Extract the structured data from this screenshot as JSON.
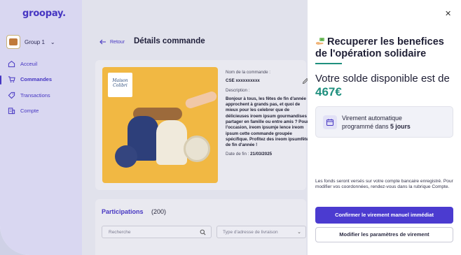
{
  "app": {
    "logo": "groopay."
  },
  "sidebar": {
    "group_label": "Group 1",
    "items": [
      {
        "label": "Acceuil",
        "icon": "home-icon",
        "active": false
      },
      {
        "label": "Commandes",
        "icon": "cart-icon",
        "active": true
      },
      {
        "label": "Transactions",
        "icon": "tag-icon",
        "active": false
      },
      {
        "label": "Compte",
        "icon": "building-icon",
        "active": false
      }
    ]
  },
  "header": {
    "back_label": "Retour",
    "title": "Détails commande"
  },
  "order": {
    "brand_tag": "Maison Colibri",
    "name_label": "Nom de la commande :",
    "name_value": "CSE xxxxxxxxxx",
    "description_label": "Description :",
    "description_text": "Bonjour à tous, les fêtes de fin d'année approchent à grands pas, et quoi de mieux pour les celebrer que de délicieuses iroem ipsum gourmandises à partager en famille ou entre amis ? Pour l'occasion, ireom ipsumje lence ireom ipsum cette commande groupée spécifique. Profitez des ireom ipsumfêtes de fin d'année !",
    "end_date_label": "Date de fin :",
    "end_date_value": "21/03/2025"
  },
  "participations": {
    "title": "Participations",
    "count": "(200)",
    "search_placeholder": "Recherche",
    "address_placeholder": "Type d'adresse de livraison"
  },
  "drawer": {
    "title": "Recuperer les benefices de l'opération solidaire",
    "balance_prefix": "Votre solde disponible est de",
    "balance_amount": "467€",
    "transfer_line1": "Virement automatique",
    "transfer_line2_prefix": "programmé dans",
    "transfer_days": "5 jours",
    "info_text": "Les fonds seront versés sur votre compte bancaire enregistré. Pour modifier vos coordonnées, rendez-vous dans la rubrique Compte.",
    "primary_button": "Confirmer le virement manuel immédiat",
    "secondary_button": "Modifier les paramètres de virement"
  },
  "colors": {
    "brand": "#4636c2",
    "accent_green": "#1f8f7e",
    "primary_button": "#4b3bd0",
    "sidebar_bg": "#d9d7f1"
  }
}
